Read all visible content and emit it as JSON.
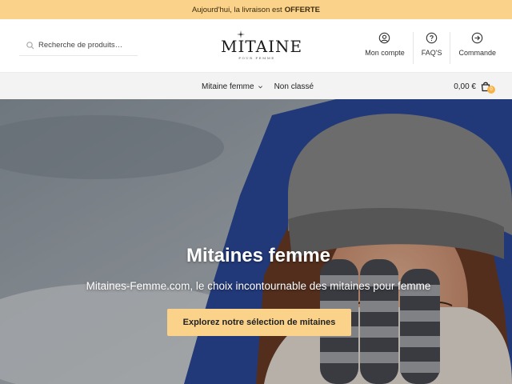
{
  "announcement": {
    "text": "Aujourd'hui, la livraison est",
    "highlight": "OFFERTE"
  },
  "search": {
    "placeholder": "Recherche de produits…",
    "icon": "search-icon"
  },
  "logo": {
    "name": "MITAINE",
    "tagline": "POUR FEMME"
  },
  "account_nav": [
    {
      "label": "Mon compte",
      "icon": "user-icon"
    },
    {
      "label": "FAQ'S",
      "icon": "help-icon"
    },
    {
      "label": "Commande",
      "icon": "arrow-right-icon"
    }
  ],
  "menu": [
    {
      "label": "Mitaine femme",
      "has_dropdown": true
    },
    {
      "label": "Non classé",
      "has_dropdown": false
    }
  ],
  "cart": {
    "total": "0,00 €",
    "count": "0",
    "icon": "shopping-bag-icon"
  },
  "hero": {
    "title": "Mitaines femme",
    "subtitle": "Mitaines-Femme.com, le choix incontournable des mitaines pour femme",
    "cta_label": "Explorez notre sélection de mitaines"
  },
  "colors": {
    "accent": "#fbd28a",
    "badge": "#f7b347"
  }
}
